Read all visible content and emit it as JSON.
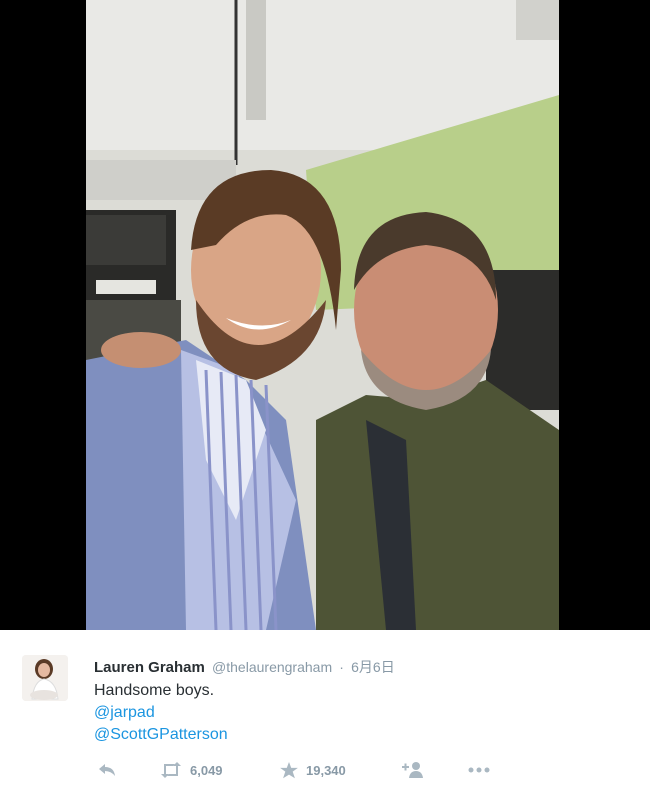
{
  "tweet": {
    "author_name": "Lauren Graham",
    "author_handle": "@thelaurengraham",
    "separator": "·",
    "date": "6月6日",
    "text_line": "Handsome boys.",
    "mentions": [
      "@jarpad",
      "@ScottGPatterson"
    ]
  },
  "actions": {
    "retweet_count": "6,049",
    "favorite_count": "19,340"
  },
  "icons": {
    "reply": "reply-icon",
    "retweet": "retweet-icon",
    "favorite": "star-icon",
    "follow": "follow-icon",
    "more": "more-icon"
  },
  "colors": {
    "name": "#292f33",
    "meta": "#8899a6",
    "link": "#1b95e0"
  }
}
